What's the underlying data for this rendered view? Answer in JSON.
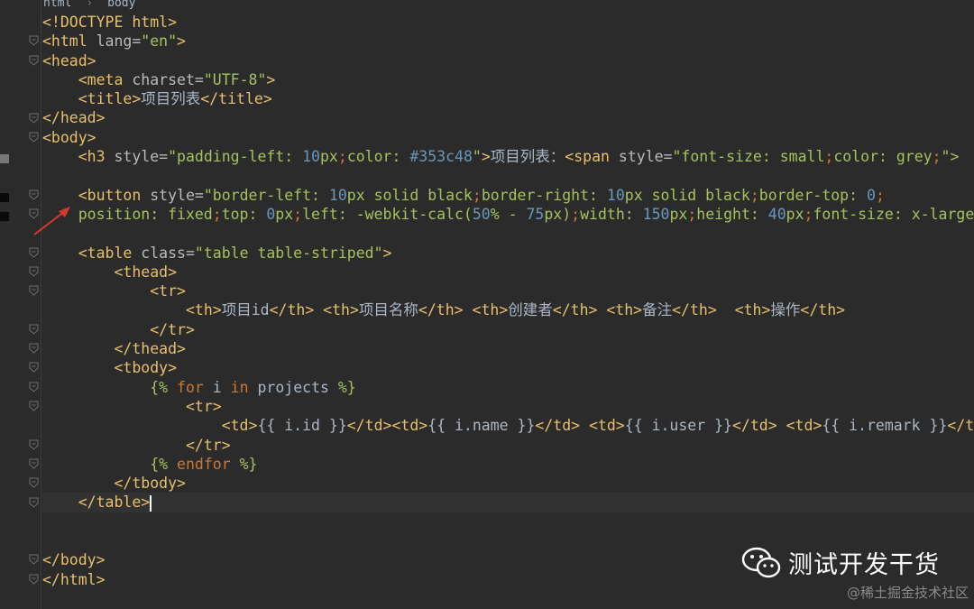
{
  "breadcrumbs": [
    "html",
    "body"
  ],
  "code_lines": [
    [
      [
        "t",
        "<!DOCTYPE html>"
      ]
    ],
    [
      [
        "t",
        "<html "
      ],
      [
        "a",
        "lang="
      ],
      [
        "s",
        "\"en\""
      ],
      [
        "t",
        ">"
      ]
    ],
    [
      [
        "t",
        "<head>"
      ]
    ],
    [
      [
        "p",
        "    "
      ],
      [
        "t",
        "<meta "
      ],
      [
        "a",
        "charset="
      ],
      [
        "s",
        "\"UTF-8\""
      ],
      [
        "t",
        ">"
      ]
    ],
    [
      [
        "p",
        "    "
      ],
      [
        "t",
        "<title>"
      ],
      [
        "p",
        "项目列表"
      ],
      [
        "t",
        "</title>"
      ]
    ],
    [
      [
        "t",
        "</head>"
      ]
    ],
    [
      [
        "t",
        "<body>"
      ]
    ],
    [
      [
        "p",
        "    "
      ],
      [
        "t",
        "<h3 "
      ],
      [
        "a",
        "style="
      ],
      [
        "s",
        "\"padding-left: "
      ],
      [
        "n",
        "10"
      ],
      [
        "s",
        "px"
      ],
      [
        "k",
        ";"
      ],
      [
        "s",
        "color: "
      ],
      [
        "n",
        "#353c48"
      ],
      [
        "s",
        "\""
      ],
      [
        "t",
        ">"
      ],
      [
        "p",
        "项目列表："
      ],
      [
        "t",
        "<span "
      ],
      [
        "a",
        "style="
      ],
      [
        "s",
        "\"font-size: small"
      ],
      [
        "k",
        ";"
      ],
      [
        "s",
        "color: grey"
      ],
      [
        "k",
        ";"
      ],
      [
        "s",
        "\">"
      ]
    ],
    [],
    [
      [
        "p",
        "    "
      ],
      [
        "t",
        "<button "
      ],
      [
        "a",
        "style="
      ],
      [
        "s",
        "\"border-left: "
      ],
      [
        "n",
        "10"
      ],
      [
        "s",
        "px solid black"
      ],
      [
        "k",
        ";"
      ],
      [
        "s",
        "border-right: "
      ],
      [
        "n",
        "10"
      ],
      [
        "s",
        "px solid black"
      ],
      [
        "k",
        ";"
      ],
      [
        "s",
        "border-top: "
      ],
      [
        "n",
        "0"
      ],
      [
        "k",
        ";"
      ]
    ],
    [
      [
        "s",
        "    position: fixed"
      ],
      [
        "k",
        ";"
      ],
      [
        "s",
        "top: "
      ],
      [
        "n",
        "0"
      ],
      [
        "s",
        "px"
      ],
      [
        "k",
        ";"
      ],
      [
        "s",
        "left: -webkit-calc("
      ],
      [
        "n",
        "50"
      ],
      [
        "s",
        "% - "
      ],
      [
        "n",
        "75"
      ],
      [
        "s",
        "px)"
      ],
      [
        "k",
        ";"
      ],
      [
        "s",
        "width: "
      ],
      [
        "n",
        "150"
      ],
      [
        "s",
        "px"
      ],
      [
        "k",
        ";"
      ],
      [
        "s",
        "height: "
      ],
      [
        "n",
        "40"
      ],
      [
        "s",
        "px"
      ],
      [
        "k",
        ";"
      ],
      [
        "s",
        "font-size: x-large"
      ]
    ],
    [],
    [
      [
        "p",
        "    "
      ],
      [
        "t",
        "<table "
      ],
      [
        "a",
        "class="
      ],
      [
        "s",
        "\"table table-striped\""
      ],
      [
        "t",
        ">"
      ]
    ],
    [
      [
        "p",
        "        "
      ],
      [
        "t",
        "<thead>"
      ]
    ],
    [
      [
        "p",
        "            "
      ],
      [
        "t",
        "<tr>"
      ]
    ],
    [
      [
        "p",
        "                "
      ],
      [
        "t",
        "<th>"
      ],
      [
        "p",
        "项目id"
      ],
      [
        "t",
        "</th> <th>"
      ],
      [
        "p",
        "项目名称"
      ],
      [
        "t",
        "</th> <th>"
      ],
      [
        "p",
        "创建者"
      ],
      [
        "t",
        "</th> <th>"
      ],
      [
        "p",
        "备注"
      ],
      [
        "t",
        "</th>  <th>"
      ],
      [
        "p",
        "操作"
      ],
      [
        "t",
        "</th>"
      ]
    ],
    [
      [
        "p",
        "            "
      ],
      [
        "t",
        "</tr>"
      ]
    ],
    [
      [
        "p",
        "        "
      ],
      [
        "t",
        "</thead>"
      ]
    ],
    [
      [
        "p",
        "        "
      ],
      [
        "t",
        "<tbody>"
      ]
    ],
    [
      [
        "p",
        "            "
      ],
      [
        "s",
        "{% "
      ],
      [
        "k",
        "for "
      ],
      [
        "p",
        "i "
      ],
      [
        "k",
        "in "
      ],
      [
        "p",
        "projects "
      ],
      [
        "s",
        "%}"
      ]
    ],
    [
      [
        "p",
        "                "
      ],
      [
        "t",
        "<tr>"
      ]
    ],
    [
      [
        "p",
        "                    "
      ],
      [
        "t",
        "<td>"
      ],
      [
        "p",
        "{{ i.id }}"
      ],
      [
        "t",
        "</td><td>"
      ],
      [
        "p",
        "{{ i.name }}"
      ],
      [
        "t",
        "</td> <td>"
      ],
      [
        "p",
        "{{ i.user }}"
      ],
      [
        "t",
        "</td> <td>"
      ],
      [
        "p",
        "{{ i.remark }}"
      ],
      [
        "t",
        "</td>"
      ]
    ],
    [
      [
        "p",
        "                "
      ],
      [
        "t",
        "</tr>"
      ]
    ],
    [
      [
        "p",
        "            "
      ],
      [
        "s",
        "{% "
      ],
      [
        "k",
        "endfor "
      ],
      [
        "s",
        "%}"
      ]
    ],
    [
      [
        "p",
        "        "
      ],
      [
        "t",
        "</tbody>"
      ]
    ],
    [
      [
        "p",
        "    "
      ],
      [
        "t",
        "</table>"
      ]
    ],
    [],
    [],
    [
      [
        "t",
        "</body>"
      ]
    ],
    [
      [
        "t",
        "</html>"
      ]
    ]
  ],
  "current_line": 25,
  "folded_lines": [
    1,
    2,
    5,
    6,
    9,
    10,
    12,
    13,
    14,
    16,
    17,
    18,
    19,
    20,
    22,
    23,
    24,
    25,
    28,
    29
  ],
  "watermark": {
    "title": "测试开发干货",
    "subtitle": "@稀土掘金技术社区",
    "icon": "wechat-icon"
  },
  "colors": {
    "background": "#2b2b2b",
    "tag": "#e8bf6a",
    "string": "#a5c25c",
    "number": "#6897bb",
    "keyword": "#cc7832",
    "text": "#a9b7c6",
    "annotation_arrow": "#d23a2a"
  }
}
